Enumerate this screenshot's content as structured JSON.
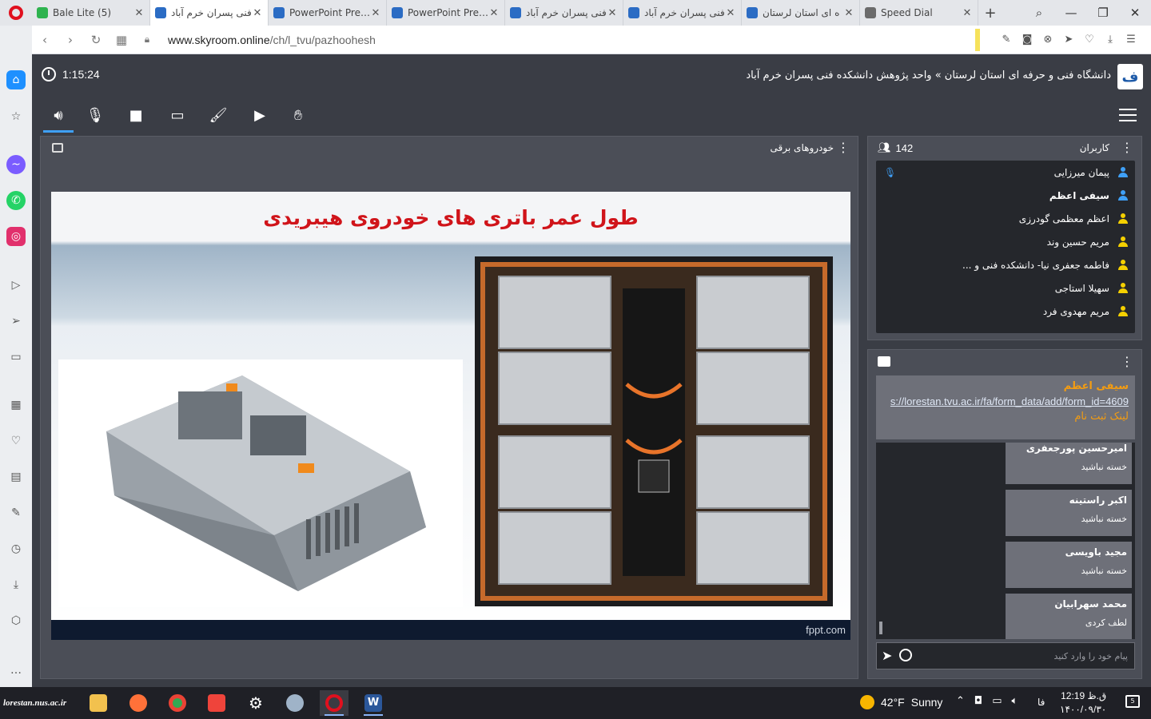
{
  "browser": {
    "tabs": [
      {
        "title": "Bale Lite (5)",
        "color": "#2eb34f",
        "active": false
      },
      {
        "title": "فنی پسران خرم آباد",
        "color": "#2b6cc4",
        "active": true
      },
      {
        "title": "PowerPoint Prese",
        "color": "#2b6cc4",
        "active": false
      },
      {
        "title": "PowerPoint Prese",
        "color": "#2b6cc4",
        "active": false
      },
      {
        "title": "فنی پسران خرم آباد",
        "color": "#2b6cc4",
        "active": false
      },
      {
        "title": "فنی پسران خرم آباد",
        "color": "#2b6cc4",
        "active": false
      },
      {
        "title": "ه ای استان لرستان",
        "color": "#2b6cc4",
        "active": false
      },
      {
        "title": "Speed Dial",
        "color": "#6b6b6b",
        "active": false
      }
    ],
    "url_host": "www.skyroom.online",
    "url_path": "/ch/l_tvu/pazhoohesh"
  },
  "room": {
    "timer": "1:15:24",
    "title": "دانشگاه فنی و حرفه ای استان لرستان » واحد پژوهش دانشکده فنی پسران خرم آباد"
  },
  "presentation": {
    "panel_title": "خودروهای برقی",
    "slide_title": "طول عمر باتری های خودروی هیبریدی",
    "footer_brand": "fppt.com"
  },
  "users": {
    "header": "کاربران",
    "count": "142",
    "list": [
      {
        "name": "پیمان میرزایی",
        "color": "#3fa0f7",
        "bold": false
      },
      {
        "name": "سیفی اعظم",
        "color": "#3fa0f7",
        "bold": true
      },
      {
        "name": "اعظم معظمی گودرزی",
        "color": "#f5d000",
        "bold": false
      },
      {
        "name": "مریم حسین وند",
        "color": "#f5d000",
        "bold": false
      },
      {
        "name": "فاطمه جعفری نیا- دانشکده فنی و ...",
        "color": "#f5d000",
        "bold": false
      },
      {
        "name": "سهیلا استاجی",
        "color": "#f5d000",
        "bold": false
      },
      {
        "name": "مریم مهدوی فرد",
        "color": "#f5d000",
        "bold": false
      }
    ]
  },
  "chat": {
    "pinned": {
      "author": "سیفی اعظم",
      "link": "s://lorestan.tvu.ac.ir/fa/form_data/add/form_id=4609",
      "text": "لینک ثبت نام"
    },
    "messages": [
      {
        "author": "امیرحسین پورجعفری",
        "text": "خسته نباشید"
      },
      {
        "author": "اکبر راستینه",
        "text": "خسته نباشید"
      },
      {
        "author": "مجید باویسی",
        "text": "خسته نباشید"
      },
      {
        "author": "محمد سهرابیان",
        "text": "لطف کردی"
      }
    ],
    "input_placeholder": "پیام خود را وارد کنید"
  },
  "taskbar": {
    "brand": "lorestan.nus.ac.ir",
    "temperature": "42°F",
    "weather": "Sunny",
    "lang": "فا",
    "time": "12:19 ق.ظ",
    "date": "۱۴۰۰/۰۹/۳۰",
    "notifications": "5"
  }
}
